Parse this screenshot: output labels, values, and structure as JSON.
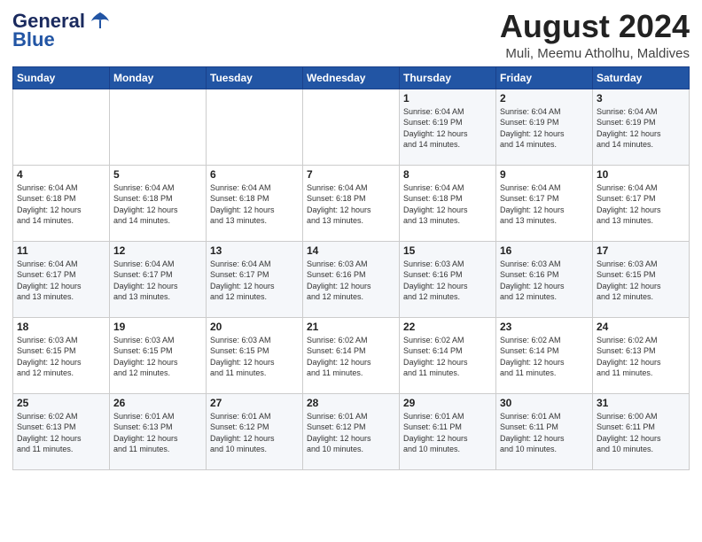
{
  "logo": {
    "line1": "General",
    "line2": "Blue"
  },
  "title": "August 2024",
  "subtitle": "Muli, Meemu Atholhu, Maldives",
  "weekdays": [
    "Sunday",
    "Monday",
    "Tuesday",
    "Wednesday",
    "Thursday",
    "Friday",
    "Saturday"
  ],
  "weeks": [
    [
      {
        "day": "",
        "info": ""
      },
      {
        "day": "",
        "info": ""
      },
      {
        "day": "",
        "info": ""
      },
      {
        "day": "",
        "info": ""
      },
      {
        "day": "1",
        "info": "Sunrise: 6:04 AM\nSunset: 6:19 PM\nDaylight: 12 hours\nand 14 minutes."
      },
      {
        "day": "2",
        "info": "Sunrise: 6:04 AM\nSunset: 6:19 PM\nDaylight: 12 hours\nand 14 minutes."
      },
      {
        "day": "3",
        "info": "Sunrise: 6:04 AM\nSunset: 6:19 PM\nDaylight: 12 hours\nand 14 minutes."
      }
    ],
    [
      {
        "day": "4",
        "info": "Sunrise: 6:04 AM\nSunset: 6:18 PM\nDaylight: 12 hours\nand 14 minutes."
      },
      {
        "day": "5",
        "info": "Sunrise: 6:04 AM\nSunset: 6:18 PM\nDaylight: 12 hours\nand 14 minutes."
      },
      {
        "day": "6",
        "info": "Sunrise: 6:04 AM\nSunset: 6:18 PM\nDaylight: 12 hours\nand 13 minutes."
      },
      {
        "day": "7",
        "info": "Sunrise: 6:04 AM\nSunset: 6:18 PM\nDaylight: 12 hours\nand 13 minutes."
      },
      {
        "day": "8",
        "info": "Sunrise: 6:04 AM\nSunset: 6:18 PM\nDaylight: 12 hours\nand 13 minutes."
      },
      {
        "day": "9",
        "info": "Sunrise: 6:04 AM\nSunset: 6:17 PM\nDaylight: 12 hours\nand 13 minutes."
      },
      {
        "day": "10",
        "info": "Sunrise: 6:04 AM\nSunset: 6:17 PM\nDaylight: 12 hours\nand 13 minutes."
      }
    ],
    [
      {
        "day": "11",
        "info": "Sunrise: 6:04 AM\nSunset: 6:17 PM\nDaylight: 12 hours\nand 13 minutes."
      },
      {
        "day": "12",
        "info": "Sunrise: 6:04 AM\nSunset: 6:17 PM\nDaylight: 12 hours\nand 13 minutes."
      },
      {
        "day": "13",
        "info": "Sunrise: 6:04 AM\nSunset: 6:17 PM\nDaylight: 12 hours\nand 12 minutes."
      },
      {
        "day": "14",
        "info": "Sunrise: 6:03 AM\nSunset: 6:16 PM\nDaylight: 12 hours\nand 12 minutes."
      },
      {
        "day": "15",
        "info": "Sunrise: 6:03 AM\nSunset: 6:16 PM\nDaylight: 12 hours\nand 12 minutes."
      },
      {
        "day": "16",
        "info": "Sunrise: 6:03 AM\nSunset: 6:16 PM\nDaylight: 12 hours\nand 12 minutes."
      },
      {
        "day": "17",
        "info": "Sunrise: 6:03 AM\nSunset: 6:15 PM\nDaylight: 12 hours\nand 12 minutes."
      }
    ],
    [
      {
        "day": "18",
        "info": "Sunrise: 6:03 AM\nSunset: 6:15 PM\nDaylight: 12 hours\nand 12 minutes."
      },
      {
        "day": "19",
        "info": "Sunrise: 6:03 AM\nSunset: 6:15 PM\nDaylight: 12 hours\nand 12 minutes."
      },
      {
        "day": "20",
        "info": "Sunrise: 6:03 AM\nSunset: 6:15 PM\nDaylight: 12 hours\nand 11 minutes."
      },
      {
        "day": "21",
        "info": "Sunrise: 6:02 AM\nSunset: 6:14 PM\nDaylight: 12 hours\nand 11 minutes."
      },
      {
        "day": "22",
        "info": "Sunrise: 6:02 AM\nSunset: 6:14 PM\nDaylight: 12 hours\nand 11 minutes."
      },
      {
        "day": "23",
        "info": "Sunrise: 6:02 AM\nSunset: 6:14 PM\nDaylight: 12 hours\nand 11 minutes."
      },
      {
        "day": "24",
        "info": "Sunrise: 6:02 AM\nSunset: 6:13 PM\nDaylight: 12 hours\nand 11 minutes."
      }
    ],
    [
      {
        "day": "25",
        "info": "Sunrise: 6:02 AM\nSunset: 6:13 PM\nDaylight: 12 hours\nand 11 minutes."
      },
      {
        "day": "26",
        "info": "Sunrise: 6:01 AM\nSunset: 6:13 PM\nDaylight: 12 hours\nand 11 minutes."
      },
      {
        "day": "27",
        "info": "Sunrise: 6:01 AM\nSunset: 6:12 PM\nDaylight: 12 hours\nand 10 minutes."
      },
      {
        "day": "28",
        "info": "Sunrise: 6:01 AM\nSunset: 6:12 PM\nDaylight: 12 hours\nand 10 minutes."
      },
      {
        "day": "29",
        "info": "Sunrise: 6:01 AM\nSunset: 6:11 PM\nDaylight: 12 hours\nand 10 minutes."
      },
      {
        "day": "30",
        "info": "Sunrise: 6:01 AM\nSunset: 6:11 PM\nDaylight: 12 hours\nand 10 minutes."
      },
      {
        "day": "31",
        "info": "Sunrise: 6:00 AM\nSunset: 6:11 PM\nDaylight: 12 hours\nand 10 minutes."
      }
    ]
  ]
}
